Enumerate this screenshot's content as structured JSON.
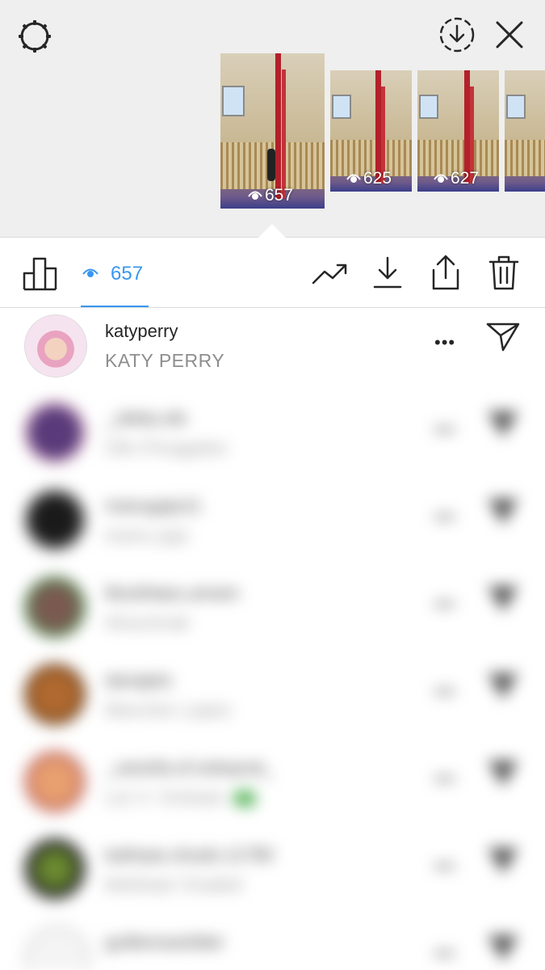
{
  "header": {
    "settings_icon": "gear-icon",
    "download_icon": "download-circle-icon",
    "close_icon": "close-icon"
  },
  "stories": [
    {
      "views": "657",
      "selected": true
    },
    {
      "views": "625",
      "selected": false
    },
    {
      "views": "627",
      "selected": false
    },
    {
      "views": "",
      "selected": false
    }
  ],
  "toolbar": {
    "insights_icon": "bar-chart-icon",
    "view_count": "657",
    "promote_icon": "trending-icon",
    "save_icon": "download-icon",
    "share_icon": "share-icon",
    "delete_icon": "trash-icon"
  },
  "viewers": [
    {
      "username": "katyperry",
      "full_name": "KATY PERRY",
      "blurred": false
    },
    {
      "username": "_ofelia.ofe",
      "full_name": "Ofe Pinagalen",
      "blurred": true
    },
    {
      "username": "manugajo11",
      "full_name": "manu jajo",
      "blurred": true
    },
    {
      "username": "lilouthlaeu.amam",
      "full_name": "Alouninak",
      "blurred": true
    },
    {
      "username": "danajets",
      "full_name": "Marchie Lopez",
      "blurred": true
    },
    {
      "username": "_xaviofa.of.ookayrat_",
      "full_name": "Lai V. Ocleats",
      "blurred": true
    },
    {
      "username": "kathaas.shudo.11780",
      "full_name": "Mahlaat Visabel",
      "blurred": true
    },
    {
      "username": "guillemoanlider",
      "full_name": "",
      "blurred": true
    }
  ],
  "colors": {
    "accent": "#3897f0",
    "text": "#262626",
    "secondary_text": "#8e8e8e",
    "header_bg": "#efefef"
  }
}
